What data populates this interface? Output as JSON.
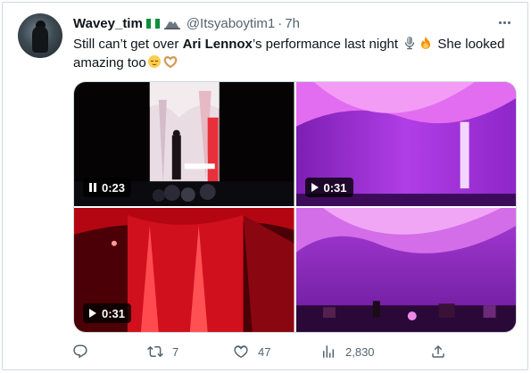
{
  "tweet": {
    "display_name": "Wavey_tim",
    "handle": "@Itsyaboytim1",
    "separator": "·",
    "time": "7h",
    "text_before": "Still can’t get over ",
    "text_bold": "Ari Lennox",
    "text_after": "’s performance last night ",
    "text_line2_a": " She looked",
    "text_line2_b": "amazing too",
    "icons": [
      "nigeria-flag-icon",
      "mountain-icon",
      "microphone-emoji",
      "fire-emoji",
      "relieved-face-emoji",
      "heart-hands-emoji"
    ]
  },
  "media": [
    {
      "type": "video",
      "duration": "0:23",
      "state": "playing",
      "control_icon": "pause-icon"
    },
    {
      "type": "video",
      "duration": "0:31",
      "state": "paused",
      "control_icon": "play-icon"
    },
    {
      "type": "video",
      "duration": "0:31",
      "state": "paused",
      "control_icon": "play-icon"
    },
    {
      "type": "image"
    }
  ],
  "actions": {
    "replies": "",
    "retweets": "7",
    "likes": "47",
    "views": "2,830"
  },
  "colors": {
    "text": "#0f1419",
    "secondary": "#536471",
    "border": "#cfd9de",
    "stage_purple": "#9b2fd6",
    "stage_red": "#d4121c"
  }
}
